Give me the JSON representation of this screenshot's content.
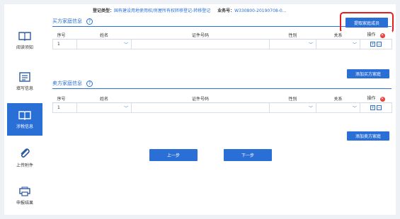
{
  "header": {
    "reg_type_label": "登记类型：",
    "reg_type_value": "国有建设用地使用权/房屋所有权转移登记-转移登记",
    "biz_no_label": "业务号：",
    "biz_no_value": "W330800-20190708-0..."
  },
  "sidebar": {
    "items": [
      {
        "label": "阅读须知",
        "icon": "book-icon"
      },
      {
        "label": "填写信息",
        "icon": "form-icon"
      },
      {
        "label": "涉税信息",
        "icon": "tax-book-icon"
      },
      {
        "label": "上传附件",
        "icon": "paperclip-icon"
      },
      {
        "label": "申报结果",
        "icon": "printer-icon"
      }
    ],
    "active_index": 2
  },
  "buyer": {
    "title": "买方家庭信息",
    "help": "?",
    "fetch_button": "提取家庭成员",
    "add_button": "添加买方家庭",
    "columns": [
      "序号",
      "姓名",
      "证件号码",
      "性别",
      "关系",
      "操作"
    ],
    "rows": [
      {
        "index": "1",
        "name": "",
        "id_no": "",
        "gender": "",
        "relation": ""
      }
    ]
  },
  "seller": {
    "title": "卖方家庭信息",
    "help": "?",
    "add_button": "添加卖方家庭",
    "columns": [
      "序号",
      "姓名",
      "证件号码",
      "性别",
      "关系",
      "操作"
    ],
    "rows": [
      {
        "index": "1",
        "name": "",
        "id_no": "",
        "gender": "",
        "relation": ""
      }
    ]
  },
  "nav": {
    "prev": "上一步",
    "next": "下一步"
  },
  "glyphs": {
    "dropdown": "﹀",
    "op_add": "+",
    "op_remove": "−",
    "delete": "✕"
  },
  "colors": {
    "accent": "#2a6fd6",
    "danger": "#e8433a",
    "highlight": "#e02020"
  }
}
